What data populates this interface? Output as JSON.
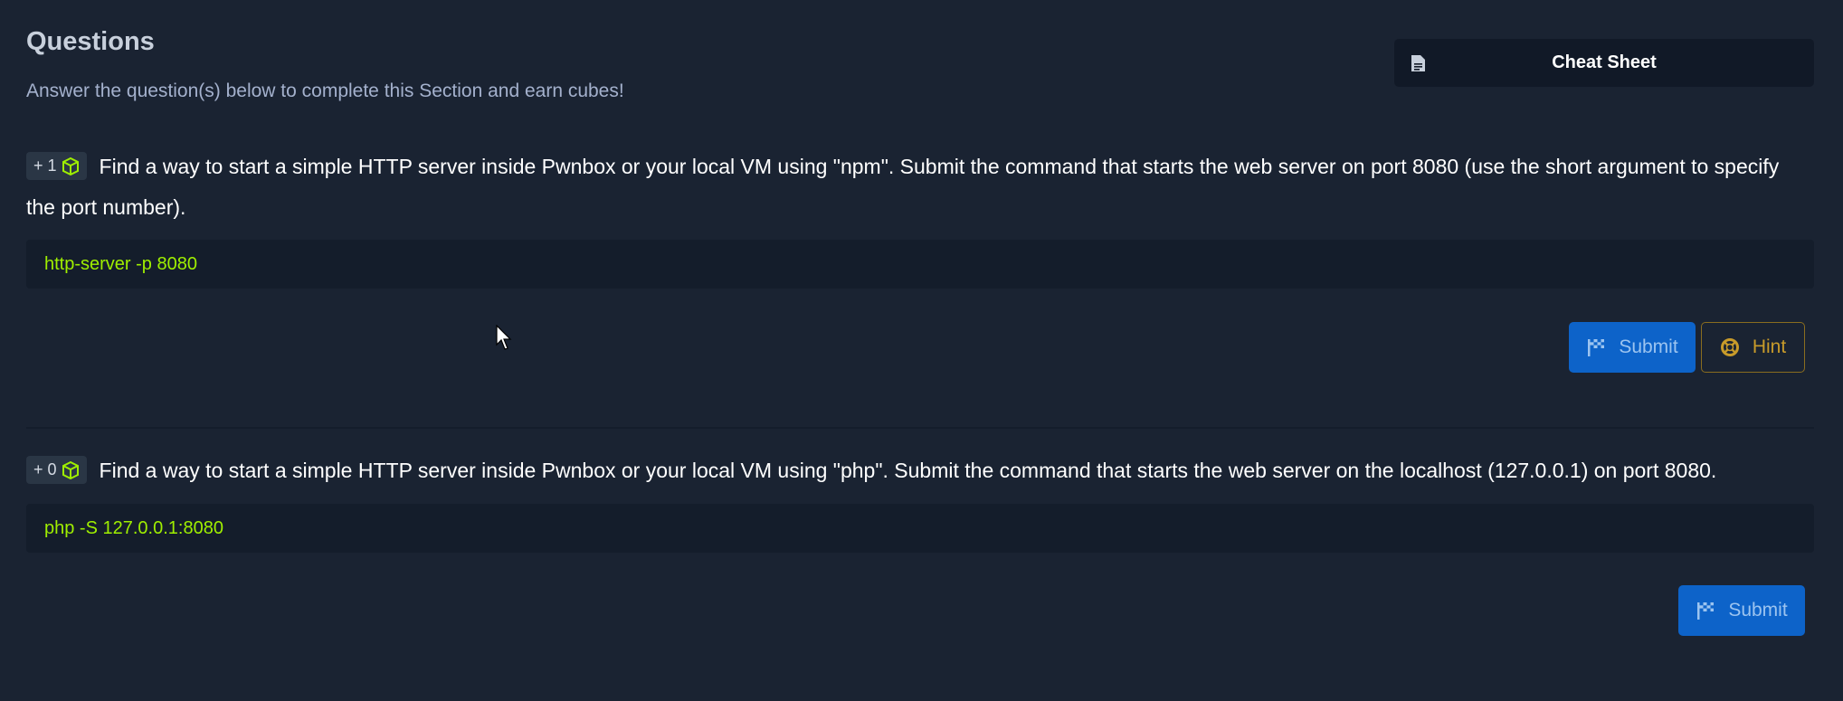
{
  "header": {
    "title": "Questions",
    "subtitle": "Answer the question(s) below to complete this Section and earn cubes!",
    "cheat_sheet_label": "Cheat Sheet"
  },
  "questions": [
    {
      "badge": "+ 1",
      "text": "Find a way to start a simple HTTP server inside Pwnbox or your local VM using \"npm\". Submit the command that starts the web server on port 8080 (use the short argument to specify the port number).",
      "answer": "http-server -p 8080",
      "submit_label": "Submit",
      "hint_label": "Hint"
    },
    {
      "badge": "+ 0",
      "text": "Find a way to start a simple HTTP server inside Pwnbox or your local VM using \"php\". Submit the command that starts the web server on the localhost (127.0.0.1) on port 8080.",
      "answer": "php -S 127.0.0.1:8080",
      "submit_label": "Submit"
    }
  ],
  "icons": {
    "cube": "cube-icon",
    "flag": "flag-icon",
    "hint": "lifebuoy-icon",
    "document": "document-icon"
  },
  "colors": {
    "background": "#1a2332",
    "answer_text": "#9fef00",
    "submit_button": "#0d63c9",
    "hint_border": "#8a6d1f"
  }
}
